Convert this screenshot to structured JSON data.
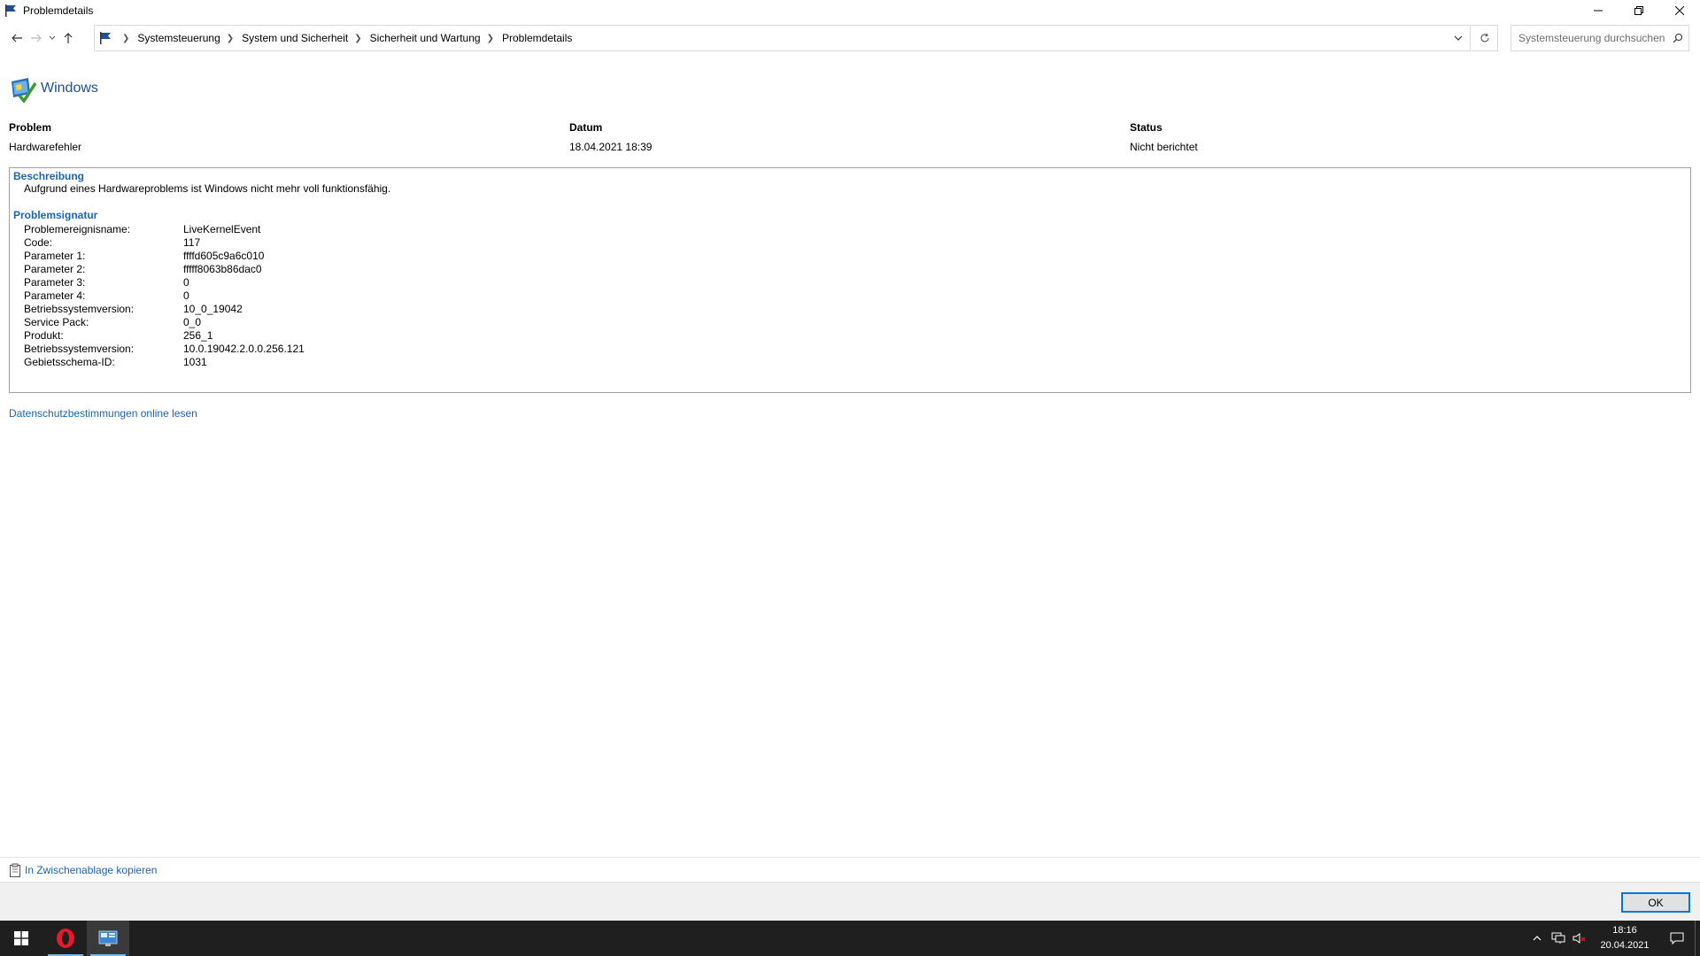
{
  "window": {
    "title": "Problemdetails"
  },
  "address": {
    "crumbs": [
      "Systemsteuerung",
      "System und Sicherheit",
      "Sicherheit und Wartung",
      "Problemdetails"
    ],
    "search_placeholder": "Systemsteuerung durchsuchen"
  },
  "brand": {
    "title": "Windows"
  },
  "summary": {
    "headers": [
      "Problem",
      "Datum",
      "Status"
    ],
    "values": [
      "Hardwarefehler",
      "18.04.2021 18:39",
      "Nicht berichtet"
    ]
  },
  "details": {
    "description_title": "Beschreibung",
    "description_text": "Aufgrund eines Hardwareproblems ist Windows nicht mehr voll funktionsfähig.",
    "signature_title": "Problemsignatur",
    "signature": [
      {
        "key": "Problemereignisname:",
        "value": "LiveKernelEvent"
      },
      {
        "key": "Code:",
        "value": "117"
      },
      {
        "key": "Parameter 1:",
        "value": "ffffd605c9a6c010"
      },
      {
        "key": "Parameter 2:",
        "value": "fffff8063b86dac0"
      },
      {
        "key": "Parameter 3:",
        "value": "0"
      },
      {
        "key": "Parameter 4:",
        "value": "0"
      },
      {
        "key": "Betriebssystemversion:",
        "value": "10_0_19042"
      },
      {
        "key": "Service Pack:",
        "value": "0_0"
      },
      {
        "key": "Produkt:",
        "value": "256_1"
      },
      {
        "key": "Betriebssystemversion:",
        "value": "10.0.19042.2.0.0.256.121"
      },
      {
        "key": "Gebietsschema-ID:",
        "value": "1031"
      }
    ]
  },
  "privacy_link": "Datenschutzbestimmungen online lesen",
  "copy_link": "In Zwischenablage kopieren",
  "ok_label": "OK",
  "taskbar": {
    "time": "18:16",
    "date": "20.04.2021"
  },
  "colors": {
    "link": "#1e63b5",
    "brand": "#1e4f9c",
    "taskbar": "#1f1f1f",
    "accent": "#0078d7"
  }
}
